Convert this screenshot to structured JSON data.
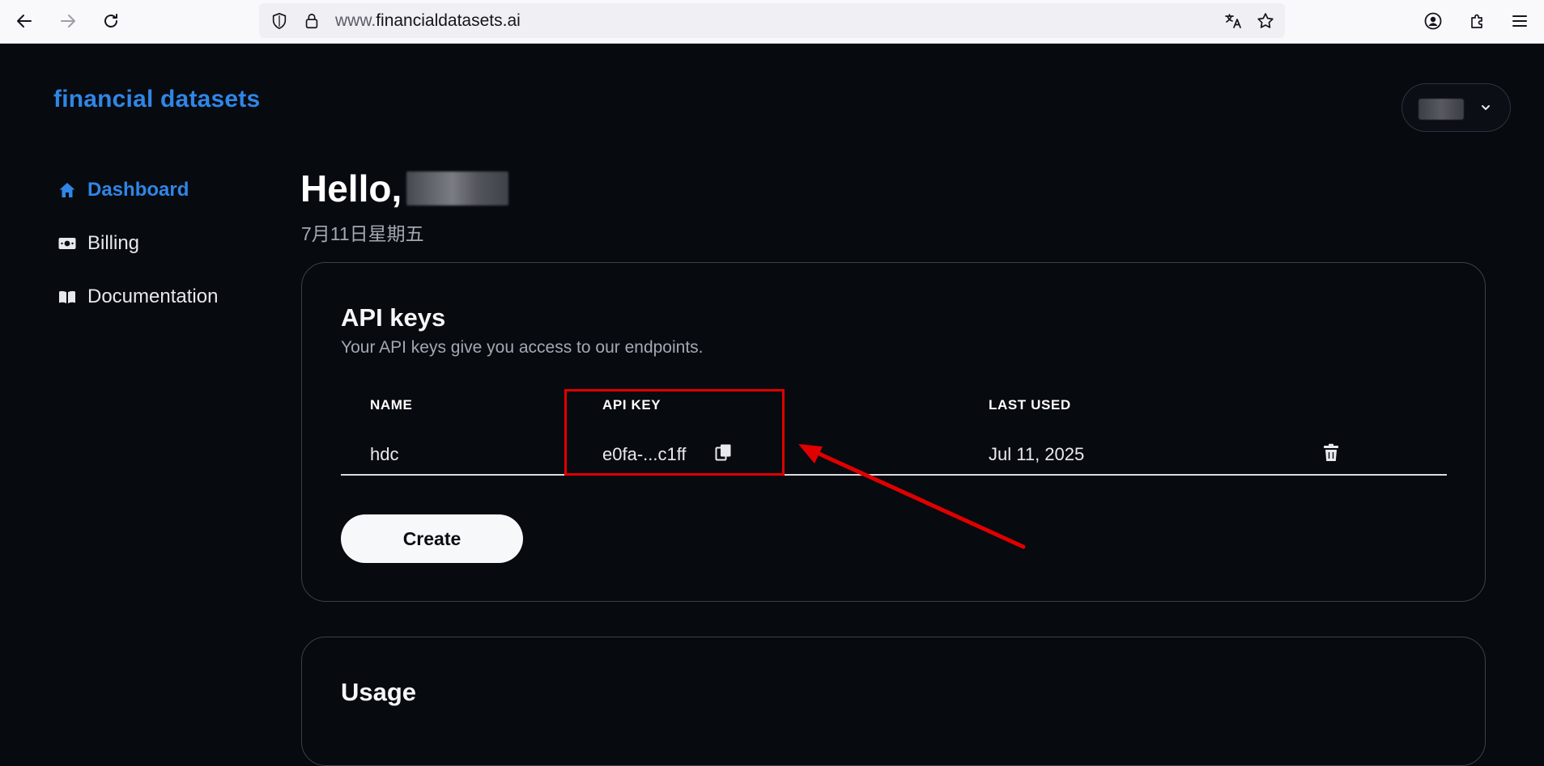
{
  "browser": {
    "url_prefix": "www.",
    "url_domain": "financialdatasets.ai",
    "icons": {
      "back": "arrow-left-icon",
      "forward": "arrow-right-icon",
      "reload": "reload-icon",
      "shield": "shield-icon",
      "lock": "lock-icon",
      "translate": "translate-icon",
      "bookmark": "star-icon",
      "account": "account-icon",
      "extensions": "puzzle-icon",
      "menu": "hamburger-menu-icon"
    }
  },
  "brand": {
    "name": "financial datasets",
    "color": "#2f86e6"
  },
  "sidebar": {
    "items": [
      {
        "label": "Dashboard",
        "icon": "home-icon",
        "active": true
      },
      {
        "label": "Billing",
        "icon": "money-icon",
        "active": false
      },
      {
        "label": "Documentation",
        "icon": "book-icon",
        "active": false
      }
    ]
  },
  "header": {
    "greeting": "Hello,",
    "date": "7月11日星期五"
  },
  "api_keys": {
    "title": "API keys",
    "subtitle": "Your API keys give you access to our endpoints.",
    "columns": [
      "NAME",
      "API KEY",
      "LAST USED"
    ],
    "rows": [
      {
        "name": "hdc",
        "api_key": "e0fa-...c1ff",
        "last_used": "Jul 11, 2025"
      }
    ],
    "create_label": "Create"
  },
  "usage": {
    "title": "Usage"
  },
  "annotation": {
    "color": "#e00000"
  }
}
